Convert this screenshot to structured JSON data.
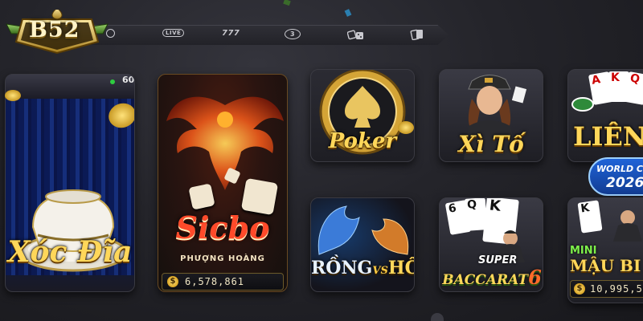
{
  "brand": {
    "logo_text": "B52"
  },
  "categories": [
    {
      "icon": "soccer-ball-icon",
      "label": ""
    },
    {
      "icon": "live-icon",
      "label": "LIVE"
    },
    {
      "icon": "slot-777-icon",
      "label": "777"
    },
    {
      "icon": "chip-3d-icon",
      "label": "3"
    },
    {
      "icon": "dice-cards-icon",
      "label": ""
    },
    {
      "icon": "playing-cards-icon",
      "label": ""
    }
  ],
  "games": {
    "xoc_dia": {
      "title": "Xóc Đĩa",
      "online_count": "60"
    },
    "sicbo": {
      "title": "Sicbo",
      "subtitle": "PHƯỢNG HOÀNG",
      "jackpot": "6,578,861"
    },
    "poker": {
      "title": "Poker"
    },
    "xi_to": {
      "title": "Xì Tố"
    },
    "lieng": {
      "title": "LIÊNG",
      "badge_line1": "WORLD C",
      "badge_line2": "2026"
    },
    "rong_ho": {
      "title_left": "RỒNG",
      "title_vs": "VS",
      "title_right": "HỔ"
    },
    "baccarat": {
      "title_top": "SUPER",
      "title_main": "BACCARAT",
      "title_num": "6"
    },
    "mau_binh": {
      "title_top": "MINI",
      "title_main": "MẬU BI",
      "jackpot": "10,995,5"
    }
  },
  "colors": {
    "gold": "#ffd75a",
    "background": "#24242a",
    "online_dot": "#2ecc40"
  }
}
